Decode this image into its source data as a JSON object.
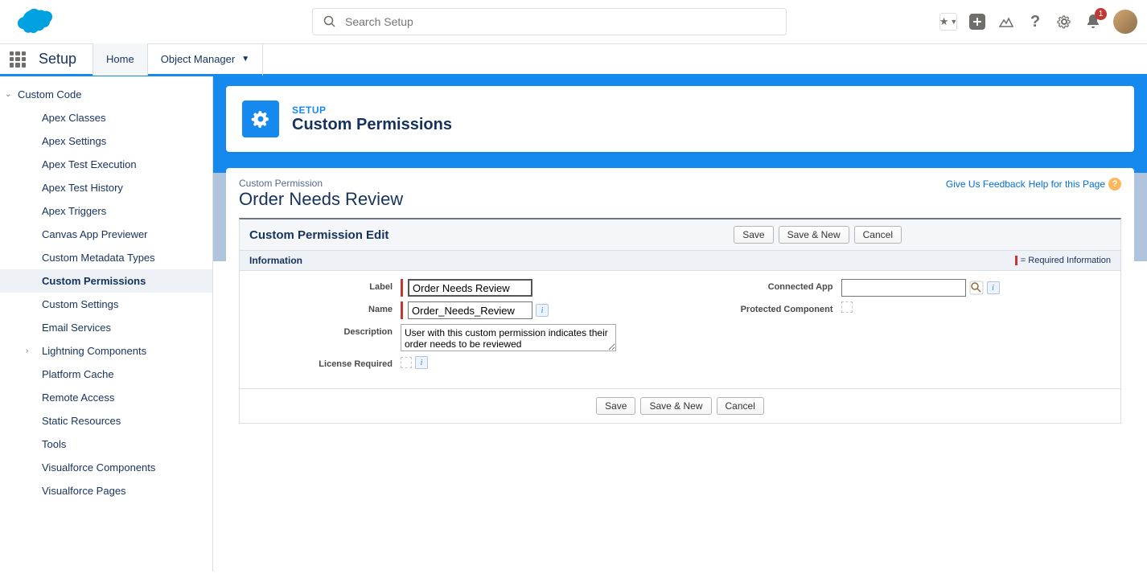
{
  "header": {
    "search_placeholder": "Search Setup",
    "notification_count": "1"
  },
  "context": {
    "app_name": "Setup",
    "tabs": [
      {
        "label": "Home",
        "active": true
      },
      {
        "label": "Object Manager",
        "active": false
      }
    ]
  },
  "sidebar": {
    "section_label": "Custom Code",
    "items": [
      {
        "label": "Apex Classes"
      },
      {
        "label": "Apex Settings"
      },
      {
        "label": "Apex Test Execution"
      },
      {
        "label": "Apex Test History"
      },
      {
        "label": "Apex Triggers"
      },
      {
        "label": "Canvas App Previewer"
      },
      {
        "label": "Custom Metadata Types"
      },
      {
        "label": "Custom Permissions",
        "active": true
      },
      {
        "label": "Custom Settings"
      },
      {
        "label": "Email Services"
      },
      {
        "label": "Lightning Components",
        "expandable": true
      },
      {
        "label": "Platform Cache"
      },
      {
        "label": "Remote Access"
      },
      {
        "label": "Static Resources"
      },
      {
        "label": "Tools"
      },
      {
        "label": "Visualforce Components"
      },
      {
        "label": "Visualforce Pages"
      }
    ]
  },
  "page": {
    "eyebrow": "SETUP",
    "title": "Custom Permissions",
    "entity_label": "Custom Permission",
    "entity_title": "Order Needs Review",
    "feedback_link": "Give Us Feedback",
    "help_link": "Help for this Page",
    "panel_title": "Custom Permission Edit",
    "info_section": "Information",
    "required_legend": "= Required Information",
    "buttons": {
      "save": "Save",
      "save_new": "Save & New",
      "cancel": "Cancel"
    }
  },
  "form": {
    "labels": {
      "label": "Label",
      "name": "Name",
      "description": "Description",
      "license": "License Required",
      "connected_app": "Connected App",
      "protected": "Protected Component"
    },
    "values": {
      "label": "Order Needs Review",
      "name": "Order_Needs_Review",
      "description": "User with this custom permission indicates their order needs to be reviewed",
      "connected_app": ""
    }
  }
}
